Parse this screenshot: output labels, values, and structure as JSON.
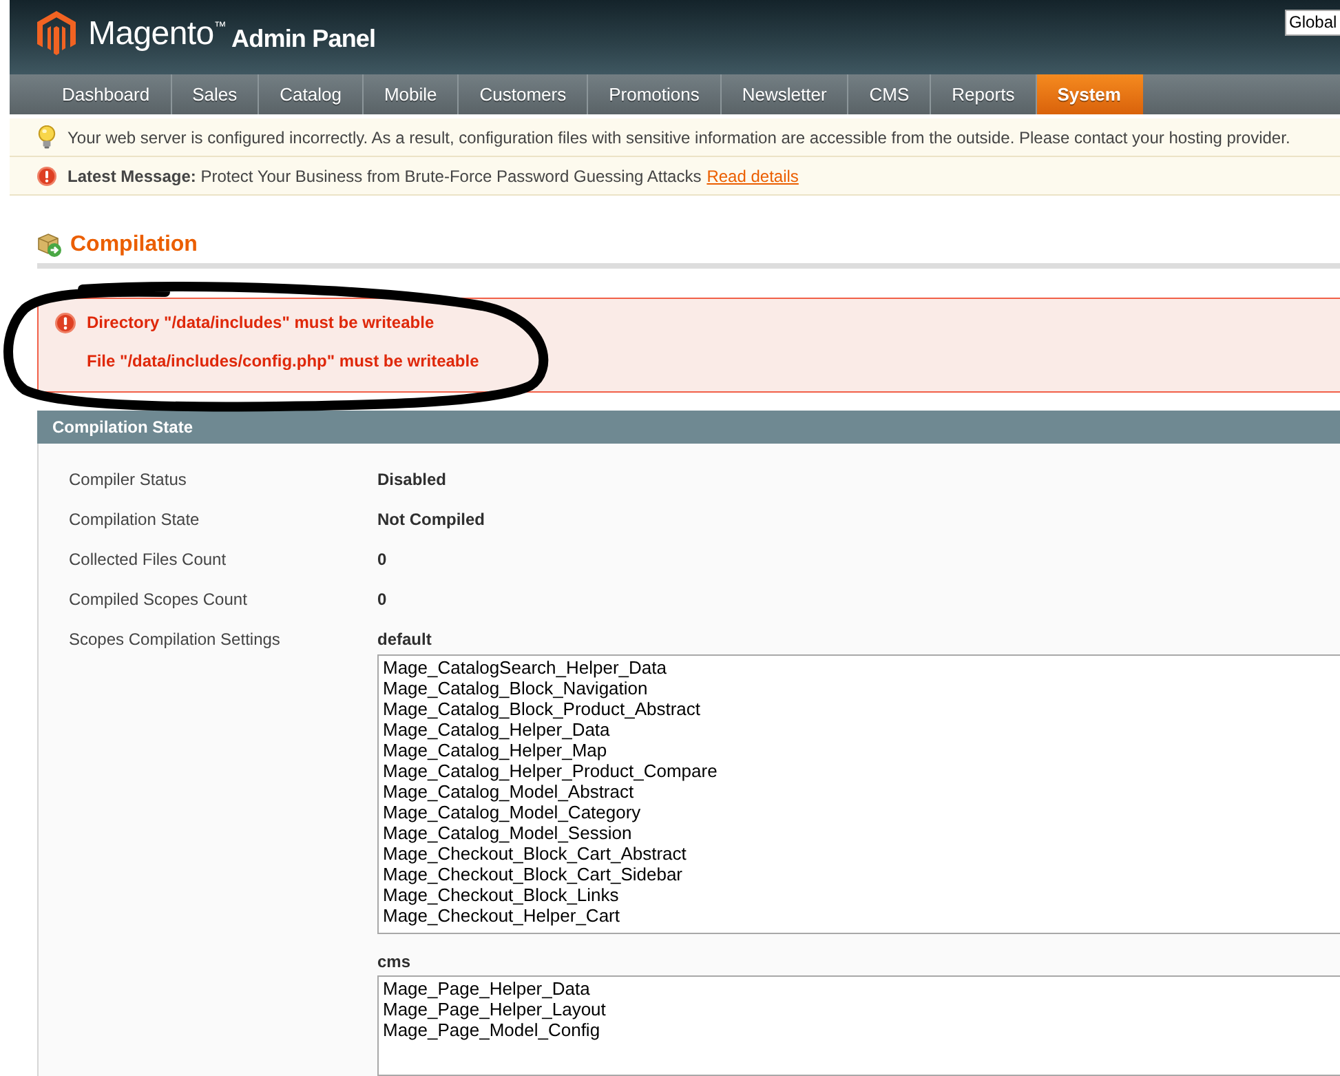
{
  "header": {
    "logo_text": "Magento$^{™}$",
    "subtitle": "Admin Panel",
    "scope_select": {
      "value": "Global"
    }
  },
  "nav": [
    {
      "label": "Dashboard",
      "selected": false
    },
    {
      "label": "Sales",
      "selected": false
    },
    {
      "label": "Catalog",
      "selected": false
    },
    {
      "label": "Mobile",
      "selected": false
    },
    {
      "label": "Customers",
      "selected": false
    },
    {
      "label": "Promotions",
      "selected": false
    },
    {
      "label": "Newsletter",
      "selected": false
    },
    {
      "label": "CMS",
      "selected": false
    },
    {
      "label": "Reports",
      "selected": false
    },
    {
      "label": "System",
      "selected": true
    }
  ],
  "notices": [
    {
      "kind": "info",
      "text": "Your web server is configured incorrectly. As a result, configuration files with sensitive information are accessible from the outside. Please contact your hosting provider."
    },
    {
      "kind": "message",
      "text": "**Latest Message:** Protect Your Business from Brute-Force Password Guessing Attacks",
      "link": "Read details"
    }
  ],
  "page_title": "Compilation",
  "errors": [
    "Directory \"/data/includes\" must be writeable",
    "File \"/data/includes/config.php\" must be writeable"
  ],
  "section": {
    "title": "Compilation State",
    "rows": [
      {
        "kind": "text",
        "label": "Compiler Status",
        "value": "Disabled"
      },
      {
        "kind": "text",
        "label": "Compilation State",
        "value": "Not Compiled"
      },
      {
        "kind": "text",
        "label": "Collected Files Count",
        "value": "0"
      },
      {
        "kind": "text",
        "label": "Compiled Scopes Count",
        "value": "0"
      },
      {
        "kind": "scopes",
        "label": "Scopes Compilation Settings",
        "scopes": [
          {
            "name": "default",
            "items": [
              "Mage_CatalogSearch_Helper_Data",
              "Mage_Catalog_Block_Navigation",
              "Mage_Catalog_Block_Product_Abstract",
              "Mage_Catalog_Helper_Data",
              "Mage_Catalog_Helper_Map",
              "Mage_Catalog_Helper_Product_Compare",
              "Mage_Catalog_Model_Abstract",
              "Mage_Catalog_Model_Category",
              "Mage_Catalog_Model_Session",
              "Mage_Checkout_Block_Cart_Abstract",
              "Mage_Checkout_Block_Cart_Sidebar",
              "Mage_Checkout_Block_Links",
              "Mage_Checkout_Helper_Cart"
            ]
          },
          {
            "name": "cms",
            "items": [
              "Mage_Page_Helper_Data",
              "Mage_Page_Helper_Layout",
              "Mage_Page_Model_Config"
            ]
          }
        ]
      }
    ]
  }
}
